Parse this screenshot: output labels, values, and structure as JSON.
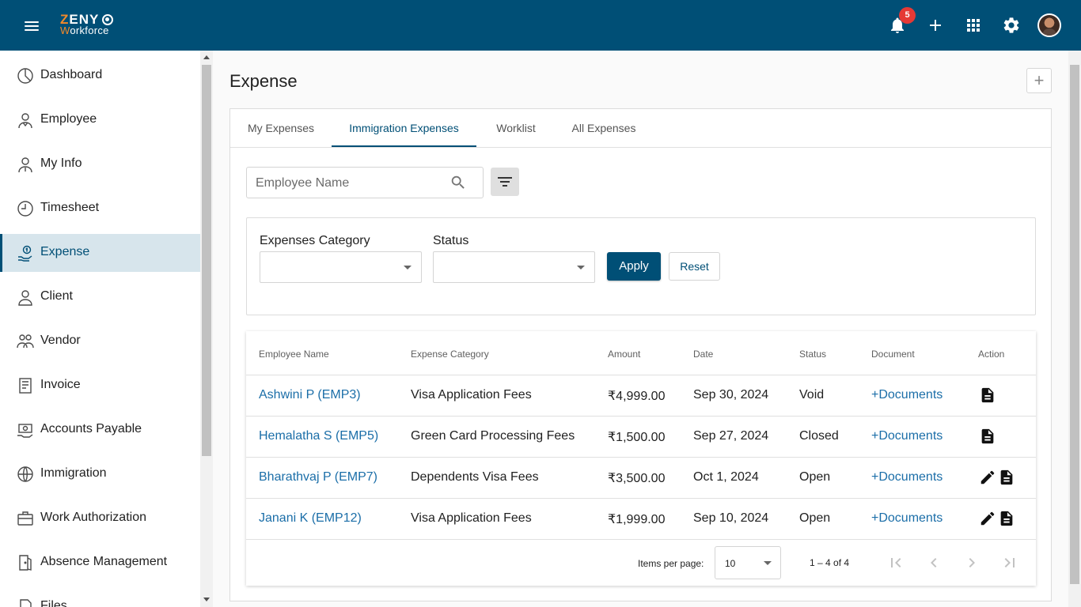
{
  "header": {
    "logo_line1_accent": "Z",
    "logo_line1_rest": "ENY",
    "logo_line2_accent": "W",
    "logo_line2_rest": "orkforce",
    "notification_count": "5",
    "icons": [
      "menu-icon",
      "bell-icon",
      "plus-icon",
      "apps-icon",
      "gear-icon",
      "avatar"
    ]
  },
  "sidebar": {
    "items": [
      {
        "label": "Dashboard",
        "icon": "dashboard-icon"
      },
      {
        "label": "Employee",
        "icon": "employee-icon"
      },
      {
        "label": "My Info",
        "icon": "my-info-icon"
      },
      {
        "label": "Timesheet",
        "icon": "clock-icon"
      },
      {
        "label": "Expense",
        "icon": "expense-icon",
        "active": true
      },
      {
        "label": "Client",
        "icon": "client-icon"
      },
      {
        "label": "Vendor",
        "icon": "vendor-icon"
      },
      {
        "label": "Invoice",
        "icon": "invoice-icon"
      },
      {
        "label": "Accounts Payable",
        "icon": "accounts-payable-icon"
      },
      {
        "label": "Immigration",
        "icon": "globe-icon"
      },
      {
        "label": "Work Authorization",
        "icon": "briefcase-icon"
      },
      {
        "label": "Absence Management",
        "icon": "door-icon"
      },
      {
        "label": "Files",
        "icon": "files-icon"
      }
    ]
  },
  "page": {
    "title": "Expense",
    "add_symbol": "+"
  },
  "tabs": [
    {
      "label": "My Expenses"
    },
    {
      "label": "Immigration Expenses",
      "active": true
    },
    {
      "label": "Worklist"
    },
    {
      "label": "All Expenses"
    }
  ],
  "search": {
    "placeholder": "Employee Name",
    "value": ""
  },
  "filters": {
    "category_label": "Expenses Category",
    "category_value": "",
    "status_label": "Status",
    "status_value": "",
    "apply_label": "Apply",
    "reset_label": "Reset"
  },
  "table": {
    "columns": [
      "Employee Name",
      "Expense Category",
      "Amount",
      "Date",
      "Status",
      "Document",
      "Action"
    ],
    "rows": [
      {
        "employee": "Ashwini P (EMP3)",
        "category": "Visa Application Fees",
        "amount": "₹4,999.00",
        "date": "Sep 30, 2024",
        "status": "Void",
        "document": "+Documents",
        "actions": [
          "document-icon"
        ]
      },
      {
        "employee": "Hemalatha S (EMP5)",
        "category": "Green Card Processing Fees",
        "amount": "₹1,500.00",
        "date": "Sep 27, 2024",
        "status": "Closed",
        "document": "+Documents",
        "actions": [
          "document-icon"
        ]
      },
      {
        "employee": "Bharathvaj P (EMP7)",
        "category": "Dependents Visa Fees",
        "amount": "₹3,500.00",
        "date": "Oct 1, 2024",
        "status": "Open",
        "document": "+Documents",
        "actions": [
          "edit-icon",
          "document-icon"
        ]
      },
      {
        "employee": "Janani K (EMP12)",
        "category": "Visa Application Fees",
        "amount": "₹1,999.00",
        "date": "Sep 10, 2024",
        "status": "Open",
        "document": "+Documents",
        "actions": [
          "edit-icon",
          "document-icon"
        ]
      }
    ]
  },
  "paginator": {
    "items_per_page_label": "Items per page:",
    "page_size": "10",
    "range": "1 – 4 of 4"
  },
  "colors": {
    "brand": "#004f76",
    "accent": "#f48a2a",
    "link": "#1b6ea8",
    "badge": "#e53935"
  }
}
